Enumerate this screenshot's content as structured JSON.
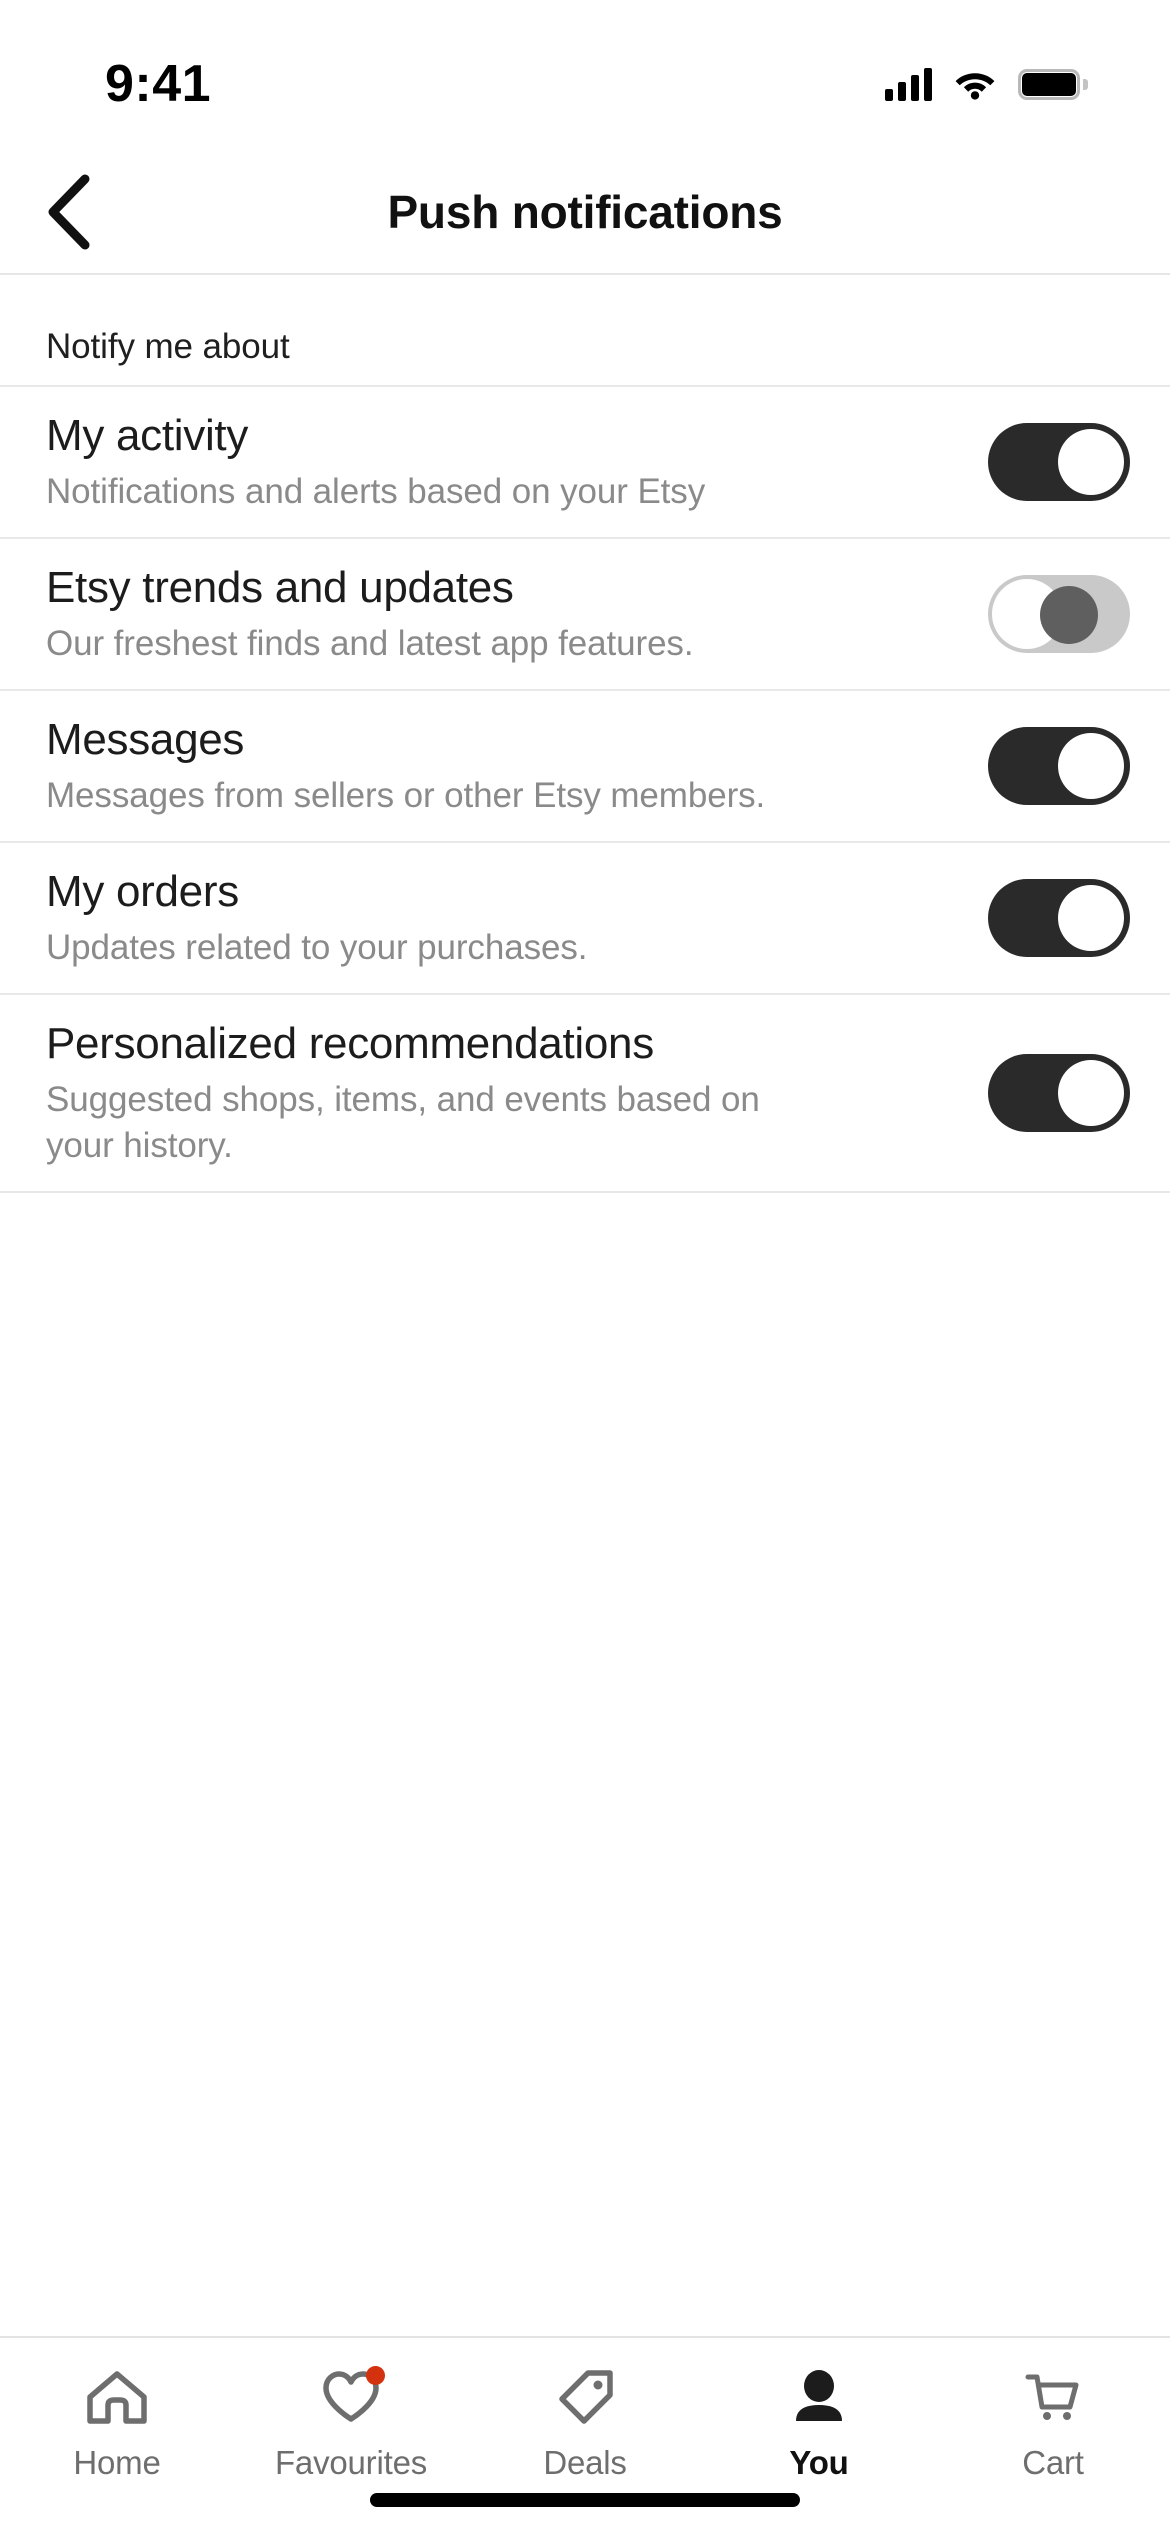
{
  "status_bar": {
    "time": "9:41",
    "signal_icon": "cellular-signal-icon",
    "wifi_icon": "wifi-icon",
    "battery_icon": "battery-full-icon"
  },
  "header": {
    "back_icon": "chevron-left-icon",
    "title": "Push notifications"
  },
  "content": {
    "section_label": "Notify me about",
    "rows": [
      {
        "title": "My activity",
        "subtitle": "Notifications and alerts based on your Etsy",
        "toggle_state": "on"
      },
      {
        "title": "Etsy trends and updates",
        "subtitle": "Our freshest finds and latest app features.",
        "toggle_state": "off"
      },
      {
        "title": "Messages",
        "subtitle": "Messages from sellers or other Etsy members.",
        "toggle_state": "on"
      },
      {
        "title": "My orders",
        "subtitle": "Updates related to your purchases.",
        "toggle_state": "on"
      },
      {
        "title": "Personalized recommendations",
        "subtitle": "Suggested shops, items, and events based on your history.",
        "toggle_state": "on"
      }
    ]
  },
  "tab_bar": {
    "tabs": [
      {
        "label": "Home",
        "icon": "home-icon",
        "active": false,
        "badge": false
      },
      {
        "label": "Favourites",
        "icon": "heart-icon",
        "active": false,
        "badge": true
      },
      {
        "label": "Deals",
        "icon": "price-tag-icon",
        "active": false,
        "badge": false
      },
      {
        "label": "You",
        "icon": "person-icon",
        "active": true,
        "badge": false
      },
      {
        "label": "Cart",
        "icon": "cart-icon",
        "active": false,
        "badge": false
      }
    ]
  },
  "colors": {
    "toggle_on": "#2a2a2a",
    "toggle_off_track": "#c9c9c9",
    "toggle_off_knob": "#5f5f5f",
    "badge": "#d4320f",
    "text_primary": "#1c1c1c",
    "text_secondary": "#8a8a8a",
    "divider": "#e8e8e8"
  }
}
